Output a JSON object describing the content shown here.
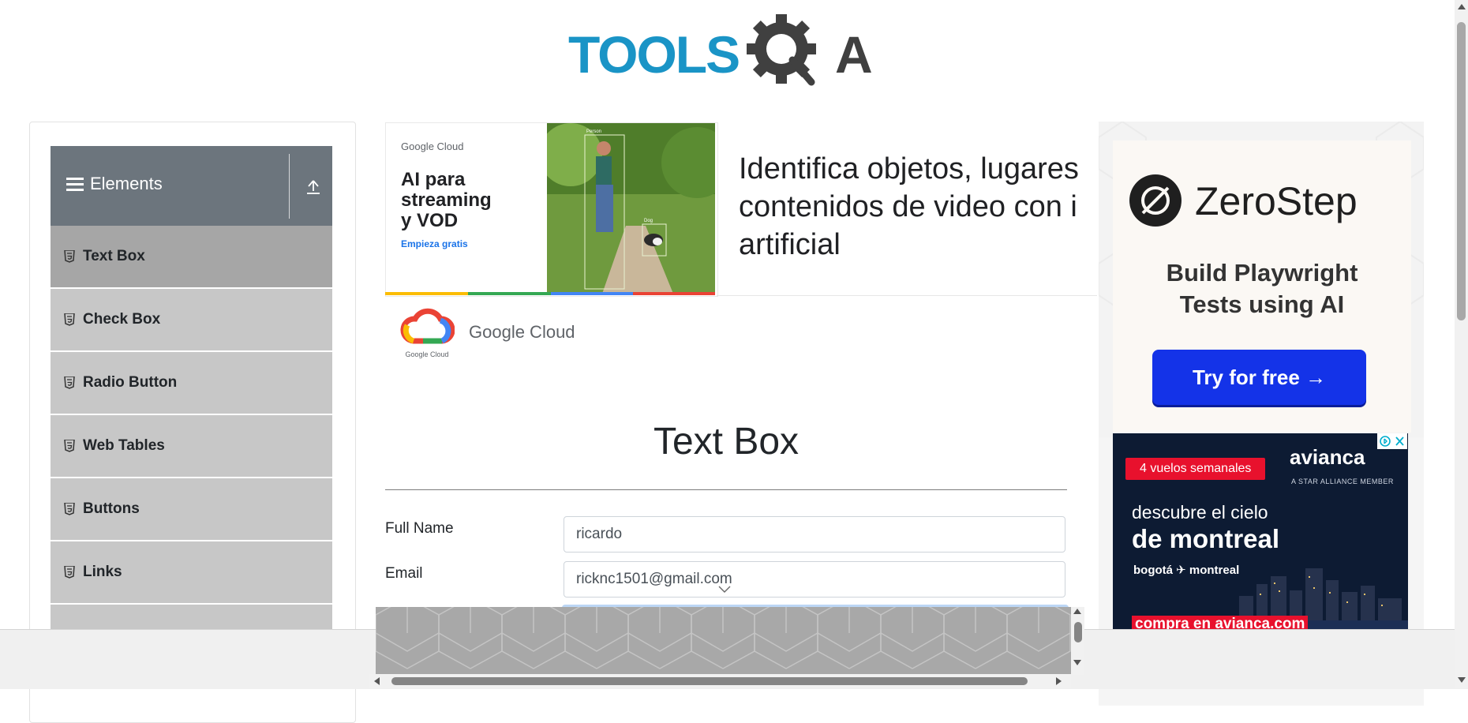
{
  "header": {
    "logo_text_primary": "TOOLS",
    "logo_text_secondary": "A",
    "brand_color": "#1a94c6"
  },
  "sidebar": {
    "group_title": "Elements",
    "items": [
      {
        "label": "Text Box",
        "active": true
      },
      {
        "label": "Check Box",
        "active": false
      },
      {
        "label": "Radio Button",
        "active": false
      },
      {
        "label": "Web Tables",
        "active": false
      },
      {
        "label": "Buttons",
        "active": false
      },
      {
        "label": "Links",
        "active": false
      }
    ]
  },
  "ad_banner": {
    "brand_small": "Google Cloud",
    "headline_lines": [
      "AI para",
      "streaming",
      "y VOD"
    ],
    "cta": "Empieza gratis",
    "photo_tags": [
      "Person",
      "Dog"
    ],
    "main_text_lines": [
      "Identifica objetos, lugares",
      "contenidos de video con i",
      "artificial"
    ],
    "advertiser_logo_caption": "Google Cloud",
    "advertiser_name": "Google Cloud"
  },
  "main": {
    "page_title": "Text Box",
    "form": {
      "full_name": {
        "label": "Full Name",
        "value": "ricardo"
      },
      "email": {
        "label": "Email",
        "value": "ricknc1501@gmail.com"
      }
    }
  },
  "ad_right": {
    "zerostep": {
      "name": "ZeroStep",
      "tagline_lines": [
        "Build Playwright",
        "Tests using AI"
      ],
      "button": "Try for free →"
    },
    "avianca": {
      "badge": "4 vuelos semanales",
      "brand": "avianca",
      "brand_sub": "A STAR ALLIANCE MEMBER",
      "line1": "descubre el cielo",
      "line2": "de montreal",
      "route": "bogotá ✈ montreal",
      "buy": "compra en avianca.com"
    }
  },
  "colors": {
    "sidebar_header": "#6c757d",
    "menu_item": "#c7c7c7",
    "menu_item_active": "#a6a6a6",
    "zerostep_button": "#1433e8",
    "avianca_red": "#e8112d"
  }
}
